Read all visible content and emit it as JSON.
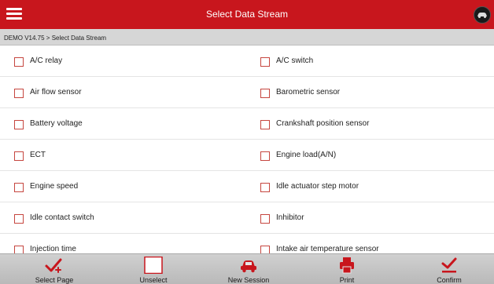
{
  "header": {
    "title": "Select Data Stream",
    "menu_icon": "menu-icon",
    "car_icon": "car-icon"
  },
  "breadcrumb": "DEMO V14.75 > Select Data Stream",
  "rows": [
    [
      "A/C relay",
      "A/C switch"
    ],
    [
      "Air flow sensor",
      "Barometric sensor"
    ],
    [
      "Battery voltage",
      "Crankshaft position sensor"
    ],
    [
      "ECT",
      "Engine load(A/N)"
    ],
    [
      "Engine speed",
      "Idle actuator step motor"
    ],
    [
      "Idle contact switch",
      "Inhibitor"
    ],
    [
      "Injection time",
      "Intake air temperature sensor"
    ]
  ],
  "toolbar": [
    {
      "label": "Select Page",
      "icon": "select-page-icon"
    },
    {
      "label": "Unselect",
      "icon": "unselect-icon"
    },
    {
      "label": "New Session",
      "icon": "new-session-icon"
    },
    {
      "label": "Print",
      "icon": "print-icon"
    },
    {
      "label": "Confirm",
      "icon": "confirm-icon"
    }
  ],
  "colors": {
    "accent": "#c8161d",
    "checkbox_border": "#c6463f",
    "toolbar_bg": "#c4c4c4"
  }
}
